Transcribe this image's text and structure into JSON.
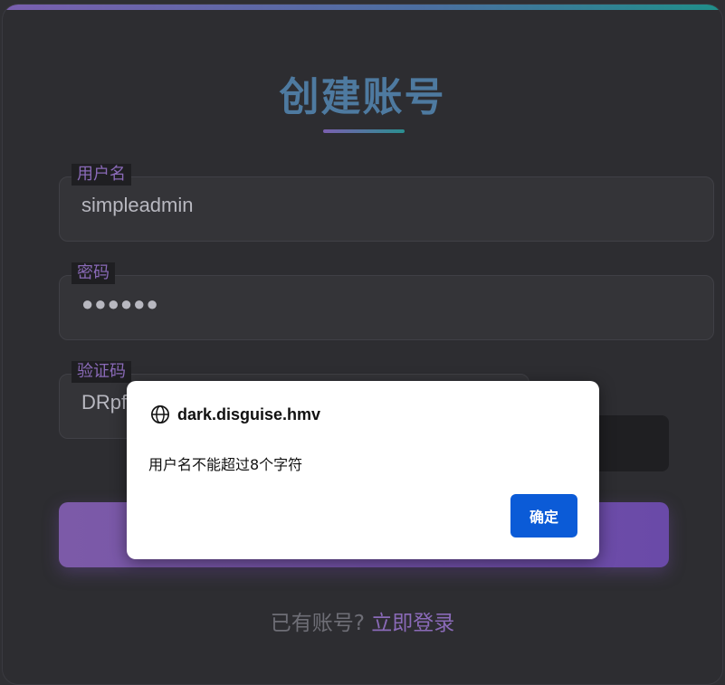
{
  "form": {
    "title": "创建账号",
    "username": {
      "label": "用户名",
      "value": "simpleadmin"
    },
    "password": {
      "label": "密码",
      "value": "●●●●●●"
    },
    "captcha": {
      "label": "验证码",
      "value": "DRpf"
    },
    "footer": {
      "text": "已有账号?",
      "link": "立即登录"
    }
  },
  "dialog": {
    "host": "dark.disguise.hmv",
    "message": "用户名不能超过8个字符",
    "ok_label": "确定",
    "icon": "globe-icon"
  },
  "colors": {
    "accent_purple": "#8a6ab8",
    "accent_teal": "#2a8f90",
    "button_blue": "#0b5bd7"
  }
}
